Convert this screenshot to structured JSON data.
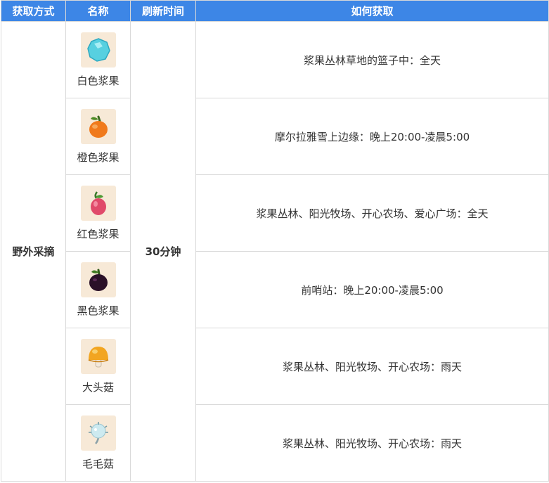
{
  "table": {
    "headers": [
      "获取方式",
      "名称",
      "刷新时间",
      "如何获取"
    ],
    "method": "野外采摘",
    "refresh": "30分钟",
    "rows": [
      {
        "name": "白色浆果",
        "icon": "white-berry-icon",
        "how": "浆果丛林草地的篮子中：全天"
      },
      {
        "name": "橙色浆果",
        "icon": "orange-berry-icon",
        "how": "摩尔拉雅雪上边缘：晚上20:00-凌晨5:00"
      },
      {
        "name": "红色浆果",
        "icon": "red-berry-icon",
        "how": "浆果丛林、阳光牧场、开心农场、爱心广场：全天"
      },
      {
        "name": "黑色浆果",
        "icon": "black-berry-icon",
        "how": "前哨站：晚上20:00-凌晨5:00"
      },
      {
        "name": "大头菇",
        "icon": "big-head-mushroom-icon",
        "how": "浆果丛林、阳光牧场、开心农场：雨天"
      },
      {
        "name": "毛毛菇",
        "icon": "fuzzy-mushroom-icon",
        "how": "浆果丛林、阳光牧场、开心农场：雨天"
      }
    ]
  },
  "colors": {
    "header_bg": "#3d86e6",
    "border": "#d9d9d9",
    "thumb_bg": "#f7e9d7"
  }
}
